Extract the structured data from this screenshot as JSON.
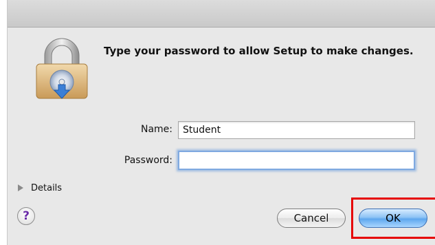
{
  "dialog": {
    "message": "Type your password to allow Setup to make changes.",
    "name_label": "Name:",
    "name_value": "Student",
    "password_label": "Password:",
    "password_value": "",
    "details_label": "Details",
    "help_glyph": "?",
    "cancel_label": "Cancel",
    "ok_label": "OK"
  },
  "icons": {
    "lock": "lock-icon",
    "disclosure": "disclosure-triangle-icon",
    "help": "help-icon"
  },
  "colors": {
    "highlight": "#e60000",
    "default_button": "#5fa7ee",
    "focus_ring": "#7fa9e0",
    "help_glyph": "#6a2ca8"
  }
}
